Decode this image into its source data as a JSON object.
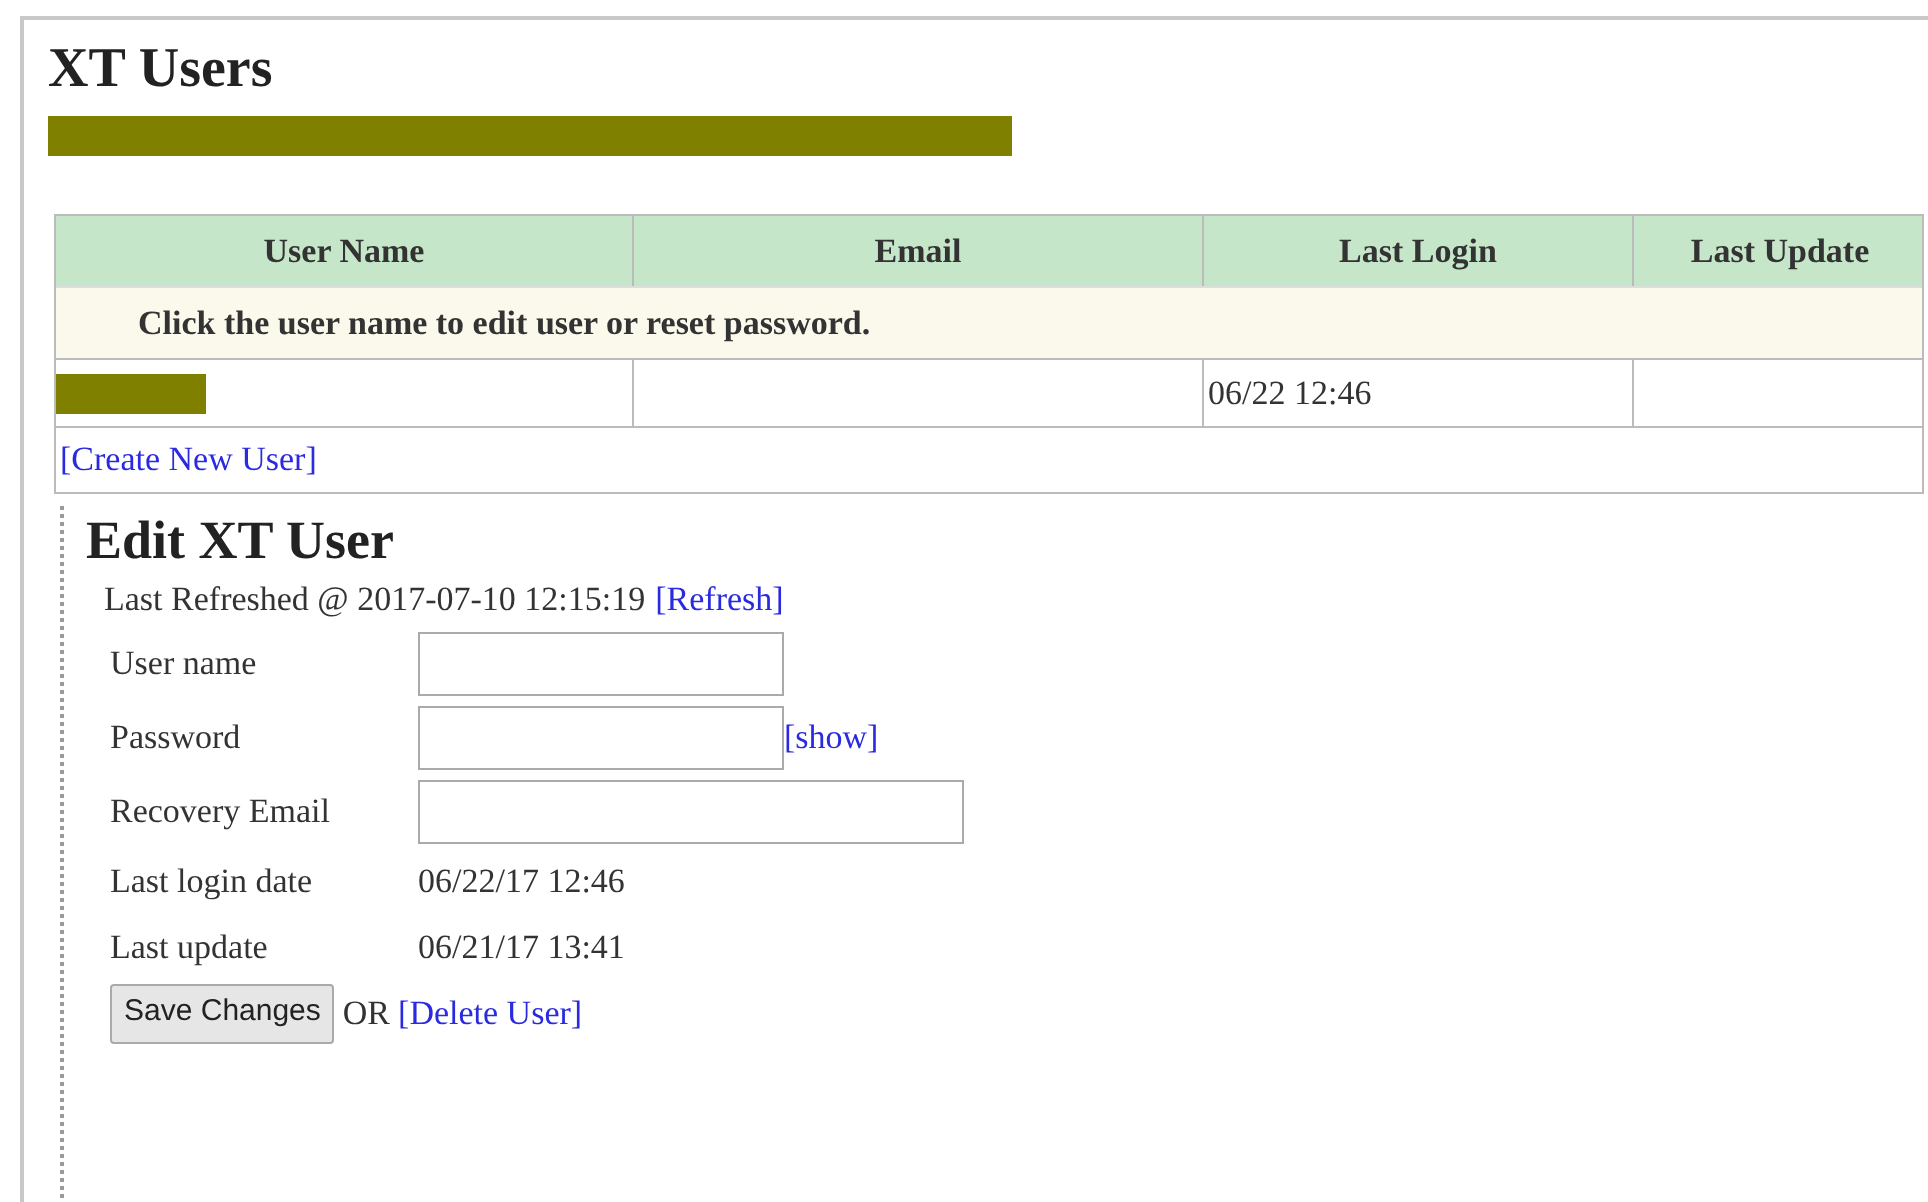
{
  "page_title": "XT Users",
  "banner": {
    "redacted": true
  },
  "table": {
    "columns": [
      "User Name",
      "Email",
      "Last Login",
      "Last Update"
    ],
    "notice": "Click the user name to edit user or reset password.",
    "rows": [
      {
        "user_name_redacted": true,
        "last_login": "06/22 12:46"
      }
    ],
    "create_link": "[Create New User]"
  },
  "edit": {
    "title": "Edit XT User",
    "refreshed": "Last Refreshed @ 2017-07-10 12:15:19",
    "refresh_link": "[Refresh]",
    "fields": [
      {
        "label": "User name",
        "wide": false
      },
      {
        "label": "Password",
        "wide": false,
        "link": "[show]"
      },
      {
        "label": "Recovery Email",
        "wide": true
      }
    ],
    "info": [
      {
        "label": "Last login date",
        "value": "06/22/17 12:46"
      },
      {
        "label": "Last update",
        "value": "06/21/17 13:41"
      }
    ],
    "save_button": "Save Changes",
    "or": "OR",
    "delete_link": "[Delete User]"
  }
}
